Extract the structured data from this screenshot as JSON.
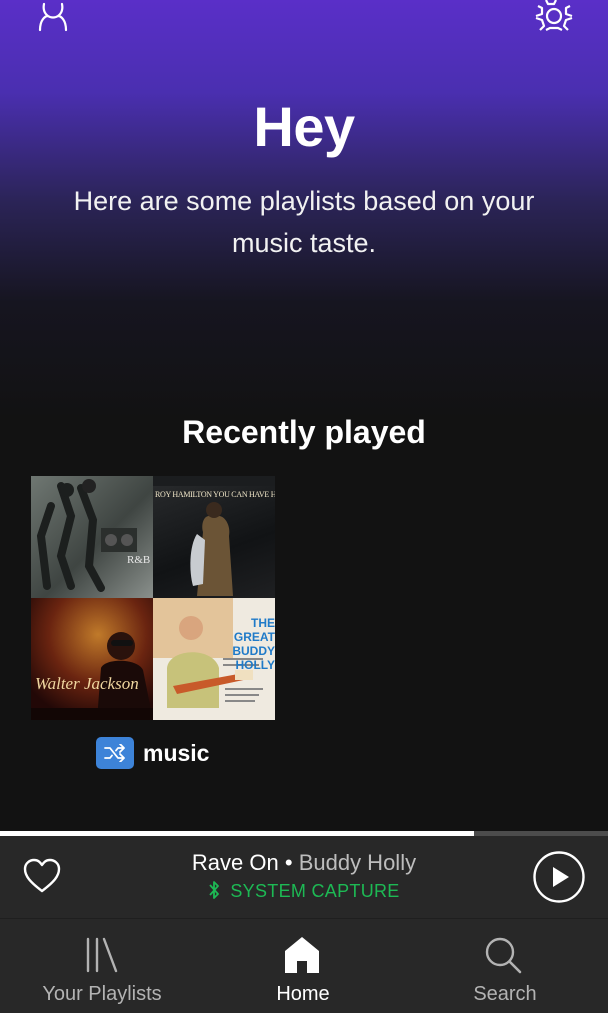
{
  "header": {
    "title": "Hey",
    "subtitle": "Here are some playlists based on your music taste.",
    "left_icon": "user-icon",
    "right_icon": "gear-icon"
  },
  "recently_played": {
    "title": "Recently played",
    "covers": [
      {
        "text": "R&B"
      },
      {
        "text": "ROY HAMILTON YOU CAN HAVE HER"
      },
      {
        "text": "Walter Jackson"
      },
      {
        "text": "THE GREAT BUDDY HOLLY"
      }
    ],
    "playlist": {
      "badge_icon": "shuffle-icon",
      "name": "music"
    }
  },
  "now_playing": {
    "track": "Rave On",
    "separator": " • ",
    "artist": "Buddy Holly",
    "device": "SYSTEM CAPTURE",
    "device_icon": "bluetooth-icon",
    "progress": 0.78,
    "like_icon": "heart-icon",
    "play_icon": "play-icon",
    "device_color": "#1db954"
  },
  "tabs": [
    {
      "label": "Your Playlists",
      "icon": "library-icon",
      "active": false
    },
    {
      "label": "Home",
      "icon": "home-icon",
      "active": true
    },
    {
      "label": "Search",
      "icon": "search-icon",
      "active": false
    }
  ],
  "colors": {
    "accent": "#1db954",
    "hero_top": "#5a2fc8",
    "background": "#121212",
    "bar": "#282828",
    "shuffle_badge": "#3d83d8"
  }
}
